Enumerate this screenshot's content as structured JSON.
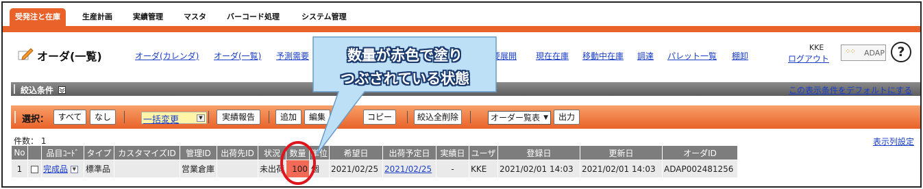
{
  "topmenu": {
    "tabs": [
      {
        "label": "受発注と在庫",
        "active": true
      },
      {
        "label": "生産計画"
      },
      {
        "label": "実績管理"
      },
      {
        "label": "マスタ"
      },
      {
        "label": "バーコード処理"
      },
      {
        "label": "システム管理"
      }
    ]
  },
  "header": {
    "title": "オーダ(一覧)",
    "links": [
      "オーダ(カレンダ)",
      "オーダ(一覧)",
      "予測需要",
      "要展開",
      "現在在庫",
      "移動中在庫",
      "調達",
      "パレット一覧",
      "棚卸"
    ],
    "user": "KKE",
    "logout": "ログアウト",
    "logo": "ADAP",
    "help": "?"
  },
  "filter": {
    "title": "絞込条件",
    "default_link": "この表示条件をデフォルトにする"
  },
  "toolbar": {
    "select_label": "選択：",
    "all": "すべて",
    "none": "なし",
    "bulk_change": "一括変更",
    "report": "実績報告",
    "add": "追加",
    "edit": "編集",
    "copy": "コピー",
    "clear_filters": "絞込全削除",
    "view_select": "オーダー覧表",
    "output": "出力"
  },
  "list": {
    "count_label": "件数：",
    "count": "1",
    "column_settings": "表示列設定",
    "columns": [
      "No",
      "品目ｺｰﾄﾞ",
      "タイプ",
      "カスタマイズID",
      "管理ID",
      "出荷先ID",
      "状況",
      "数量",
      "単位",
      "希望日",
      "出荷予定日",
      "実績日",
      "ユーザ",
      "登録日",
      "更新日",
      "オーダID"
    ],
    "rows": [
      [
        "1",
        "完成品",
        "標準品",
        "",
        "営業倉庫",
        "",
        "未出荷",
        "100",
        "個",
        "2021/02/25",
        "2021/02/25",
        "-",
        "KKE",
        "2021/02/01 14:03",
        "2021/02/01 14:03",
        "ADAP002481256"
      ]
    ]
  },
  "annotation": {
    "line1": "数量が赤色で塗り",
    "line2": "つぶされている状態"
  },
  "colors": {
    "accent": "#e8622a",
    "qty_highlight": "#f26a55",
    "callout_fill": "#bde0f7",
    "circle": "#e0141c"
  }
}
